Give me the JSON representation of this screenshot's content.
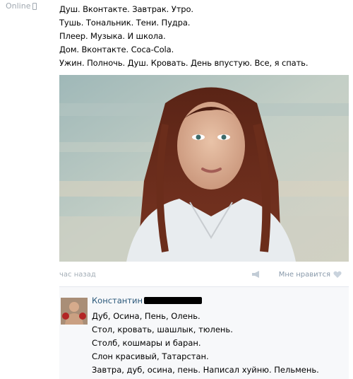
{
  "status": {
    "online_label": "Online",
    "icon": "mobile-phone-icon"
  },
  "post": {
    "lines": [
      "Душ. Вконтакте. Завтрак. Утро.",
      "Тушь. Тональник. Тени. Пудра.",
      "Плеер. Музыка. И школа.",
      "Дом. Вконтакте. Coca-Cola.",
      "Ужин. Полночь. Душ. Кровать. День впустую. Все, я спать."
    ],
    "time": "час назад",
    "like_label": "Мне нравится",
    "share_icon": "megaphone-icon",
    "like_icon": "heart-icon"
  },
  "comment": {
    "author": "Константин",
    "lines": [
      "Дуб, Осина, Пень, Олень.",
      "Стол, кровать, шашлык, тюлень.",
      "Столб, кошмары и баран.",
      "Слон красивый, Татарстан.",
      "Завтра, дуб, осина, пень. Написал хуйню. Пельмень."
    ]
  },
  "colors": {
    "link": "#2b587a",
    "muted": "#a3adb6",
    "comment_bg": "#f7f8fa"
  }
}
